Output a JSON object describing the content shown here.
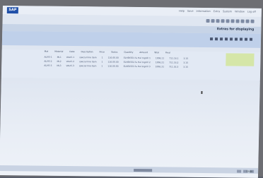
{
  "window": {
    "app_name": "SAP"
  },
  "top_menu": [
    "Help",
    "Save",
    "Information",
    "Extra",
    "System",
    "Window",
    "Log off"
  ],
  "banner": {
    "title": "Extras for displaying"
  },
  "table": {
    "headers": [
      "Mat",
      "Material",
      "Date",
      "Description",
      "Price",
      "Status",
      "Quantity",
      "Amount",
      "Total",
      "Final"
    ],
    "rows": [
      [
        "ALVIS-1",
        "ML1",
        "VALIS-1",
        "special line item",
        "1",
        "116.00.00",
        "ELHEKS01 fa Hal Ingnill 1",
        "1006.11",
        "711.16.1",
        "3.15"
      ],
      [
        "ALVIS-2",
        "ML2",
        "VALIS-2",
        "special line item",
        "1",
        "116.00.00",
        "ELHEKS02 fa Hal Ingnill 2",
        "1006.21",
        "711.16.2",
        "3.15"
      ],
      [
        "ALVIS-3",
        "ML3",
        "VALIS-3",
        "special line item",
        "1",
        "116.00.00",
        "ELHEKS03 fa Hal Ingnill 3",
        "1006.31",
        "711.16.3",
        "3.15"
      ]
    ]
  },
  "taskbar": {
    "clock": "12:00"
  }
}
